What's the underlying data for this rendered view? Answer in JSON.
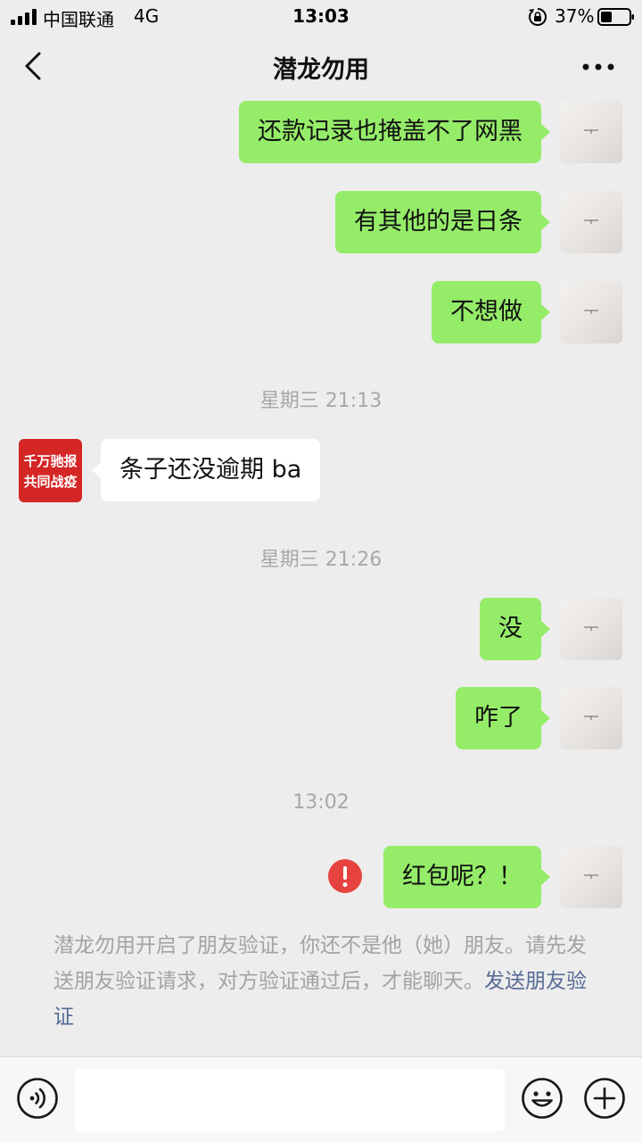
{
  "status_bar": {
    "carrier": "中国联通",
    "network": "4G",
    "time": "13:03",
    "battery_percent": "37%"
  },
  "header": {
    "title": "潜龙勿用",
    "back_icon": "chevron-left-icon",
    "more_icon": "ellipsis-icon"
  },
  "colors": {
    "outgoing_bubble": "#95EC69",
    "incoming_bubble": "#FFFFFF",
    "background": "#EDEDED",
    "link": "#576B95",
    "error": "#E64340"
  },
  "messages": [
    {
      "direction": "out",
      "text": "还款记录也掩盖不了网黑"
    },
    {
      "direction": "out",
      "text": "有其他的是日条"
    },
    {
      "direction": "out",
      "text": "不想做"
    },
    {
      "type": "timestamp",
      "text": "星期三 21:13"
    },
    {
      "direction": "in",
      "text": "条子还没逾期 ba"
    },
    {
      "type": "timestamp",
      "text": "星期三 21:26"
    },
    {
      "direction": "out",
      "text": "没"
    },
    {
      "direction": "out",
      "text": "咋了"
    },
    {
      "type": "timestamp",
      "text": "13:02"
    },
    {
      "direction": "out",
      "text": "红包呢？！",
      "status": "failed"
    }
  ],
  "contact_avatar": {
    "line1": "千万驰报",
    "line2": "共同战疫"
  },
  "notice": {
    "text": "潜龙勿用开启了朋友验证，你还不是他（她）朋友。请先发送朋友验证请求，对方验证通过后，才能聊天。",
    "link_text": "发送朋友验证"
  },
  "input_bar": {
    "voice_icon": "voice-icon",
    "input_value": "",
    "emoji_icon": "emoji-icon",
    "plus_icon": "plus-icon"
  }
}
